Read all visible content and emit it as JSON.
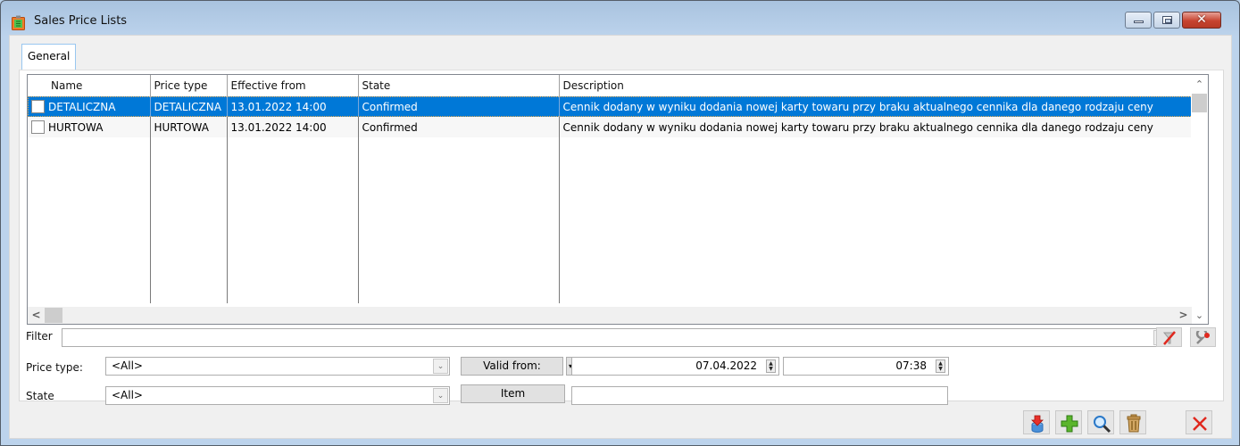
{
  "window": {
    "title": "Sales Price Lists",
    "icon": "price-list-icon",
    "controls": [
      "minimize-icon",
      "maximize-icon",
      "close-icon"
    ]
  },
  "tabs": [
    {
      "label": "General",
      "active": true
    }
  ],
  "grid": {
    "columns": [
      "Name",
      "Price type",
      "Effective from",
      "State",
      "Description"
    ],
    "rows": [
      {
        "selected": true,
        "checked": false,
        "name": "DETALICZNA",
        "price_type": "DETALICZNA",
        "effective_from": "13.01.2022 14:00",
        "state": "Confirmed",
        "description": "Cennik dodany w wyniku dodania nowej karty towaru przy braku aktualnego cennika dla danego rodzaju ceny"
      },
      {
        "selected": false,
        "checked": false,
        "name": "HURTOWA",
        "price_type": "HURTOWA",
        "effective_from": "13.01.2022 14:00",
        "state": "Confirmed",
        "description": "Cennik dodany w wyniku dodania nowej karty towaru przy braku aktualnego cennika dla danego rodzaju ceny"
      }
    ]
  },
  "filter": {
    "label": "Filter",
    "value": "",
    "clear_icon": "clear-filter-icon",
    "builder_icon": "filter-builder-icon"
  },
  "price_type": {
    "label": "Price type:",
    "value": "<All>"
  },
  "state": {
    "label": "State",
    "value": "<All>"
  },
  "valid_from": {
    "button_label": "Valid from:",
    "date": "07.04.2022",
    "time": "07:38"
  },
  "item": {
    "button_label": "Item",
    "value": ""
  },
  "toolbar": {
    "icons": [
      "import-icon",
      "add-icon",
      "preview-icon",
      "delete-icon",
      "close-icon"
    ]
  },
  "colors": {
    "selection": "#0078d7",
    "close_red": "#e03a2f",
    "add_green": "#5ab52c"
  }
}
